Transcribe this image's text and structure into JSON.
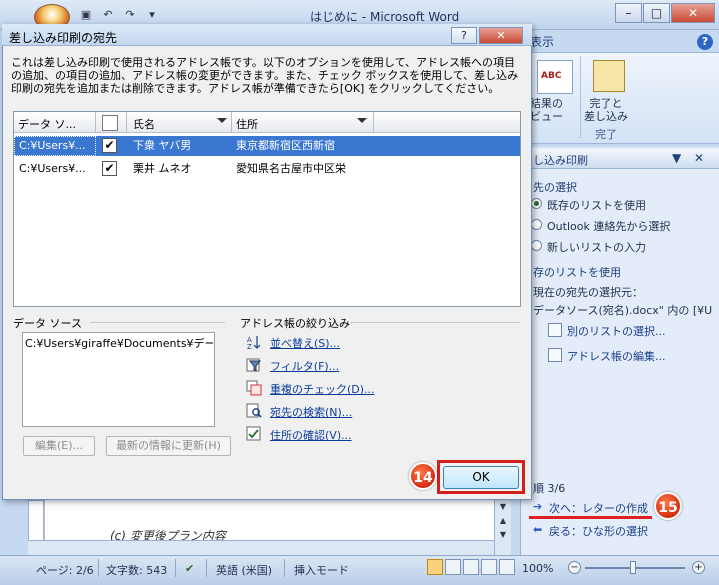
{
  "word": {
    "title": "はじめに - Microsoft Word",
    "ribbon_tab": "表示",
    "ribbon_preview_label_1": "結果の",
    "ribbon_preview_label_2": "ビュー",
    "ribbon_finish_label_1": "完了と",
    "ribbon_finish_label_2": "差し込み",
    "ribbon_group": "完了",
    "document_text": "(c)  変更後プラン内容"
  },
  "task_pane": {
    "title": "し込み印刷",
    "section_select": "先の選択",
    "radio_existing": "既存のリストを使用",
    "radio_outlook": "Outlook 連絡先から選択",
    "radio_new": "新しいリストの入力",
    "section_use": "存のリストを使用",
    "current_label": "現在の宛先の選択元：",
    "current_value": "データソース(宛名).docx\" 内の [¥U",
    "link_other_list": "別のリストの選択...",
    "link_edit": "アドレス帳の編集...",
    "step": "順 3/6",
    "next": "次へ：レターの作成",
    "back": "戻る：ひな形の選択"
  },
  "statusbar": {
    "page": "ページ: 2/6",
    "words": "文字数: 543",
    "language": "英語 (米国)",
    "mode": "挿入モード",
    "zoom": "100%"
  },
  "dialog": {
    "title": "差し込み印刷の宛先",
    "description": "これは差し込み印刷で使用されるアドレス帳です。以下のオプションを使用して、アドレス帳への項目の追加、の項目の追加、アドレス帳の変更ができます。また、チェック ボックスを使用して、差し込み印刷の宛先を追加または削除できます。アドレス帳が準備できたら[OK] をクリックしてください。",
    "columns": [
      "データ ソ...",
      "氏名",
      "住所"
    ],
    "rows": [
      {
        "source": "C:¥Users¥...",
        "checked": true,
        "name": "下衆  ヤバ男",
        "address": "東京都新宿区西新宿"
      },
      {
        "source": "C:¥Users¥...",
        "checked": true,
        "name": "栗井  ムネオ",
        "address": "愛知県名古屋市中区栄"
      }
    ],
    "datasource_label": "データ ソース",
    "datasource_value": "C:¥Users¥giraffe¥Documents¥データ",
    "btn_edit": "編集(E)...",
    "btn_refresh": "最新の情報に更新(H)",
    "filter_label": "アドレス帳の絞り込み",
    "links": [
      "並べ替え(S)...",
      "フィルタ(F)...",
      "重複のチェック(D)...",
      "宛先の検索(N)...",
      "住所の確認(V)..."
    ],
    "ok": "OK"
  },
  "callouts": {
    "ok_step": "14",
    "next_step": "15"
  },
  "colors": {
    "highlight": "#d41f1f",
    "selected_row": "#3a77d0"
  }
}
